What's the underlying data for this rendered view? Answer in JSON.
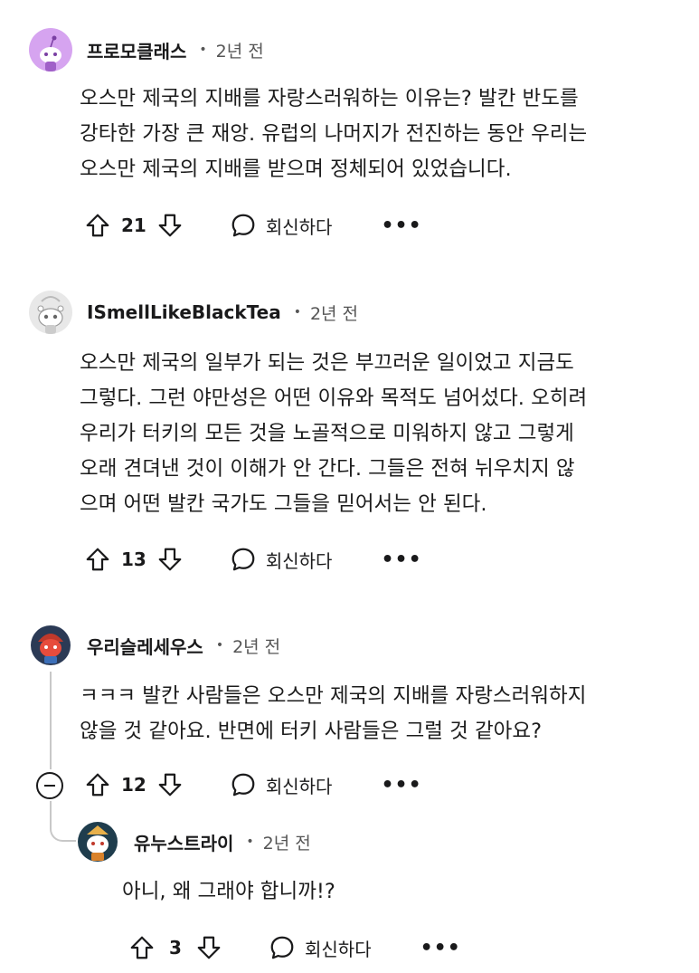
{
  "comments": [
    {
      "username": "프로모클래스",
      "time": "2년 전",
      "body": "오스만 제국의 지배를 자랑스러워하는 이유는? 발칸 반도를\n강타한 가장 큰 재앙. 유럽의 나머지가 전진하는 동안 우리는\n오스만 제국의 지배를 받으며 정체되어 있었습니다.",
      "score": "21",
      "reply_label": "회신하다",
      "more_label": "•••"
    },
    {
      "username": "ISmellLikeBlackTea",
      "time": "2년 전",
      "body": "오스만 제국의 일부가 되는 것은 부끄러운 일이었고 지금도\n그렇다. 그런 야만성은 어떤 이유와 목적도 넘어섰다. 오히려\n우리가 터키의 모든 것을 노골적으로 미워하지 않고 그렇게\n오래 견뎌낸 것이 이해가 안 간다. 그들은 전혀 뉘우치지 않\n으며 어떤 발칸 국가도 그들을 믿어서는 안 된다.",
      "score": "13",
      "reply_label": "회신하다",
      "more_label": "•••"
    },
    {
      "username": "우리슬레세우스",
      "time": "2년 전",
      "body": "ㅋㅋㅋ 발칸 사람들은 오스만 제국의 지배를 자랑스러워하지\n않을 것 같아요. 반면에 터키 사람들은 그럴 것 같아요?",
      "score": "12",
      "reply_label": "회신하다",
      "more_label": "•••"
    },
    {
      "username": "유누스트라이",
      "time": "2년 전",
      "body": "아니, 왜 그래야 합니까!?",
      "score": "3",
      "reply_label": "회신하다",
      "more_label": "•••"
    }
  ],
  "separator_dot": "•",
  "colors": {
    "text": "#1a1a1b",
    "meta": "#555555",
    "thread_line": "#c8c8c8",
    "avatar1_bg": "#d6a4f0",
    "avatar2_bg": "#e8e8e8",
    "avatar3_bg": "#2b3a55",
    "avatar4_bg": "#1f3d4d"
  },
  "icons": [
    "snoo-avatar-icon",
    "upvote-icon",
    "downvote-icon",
    "comment-bubble-icon",
    "more-options-icon",
    "collapse-thread-icon"
  ]
}
